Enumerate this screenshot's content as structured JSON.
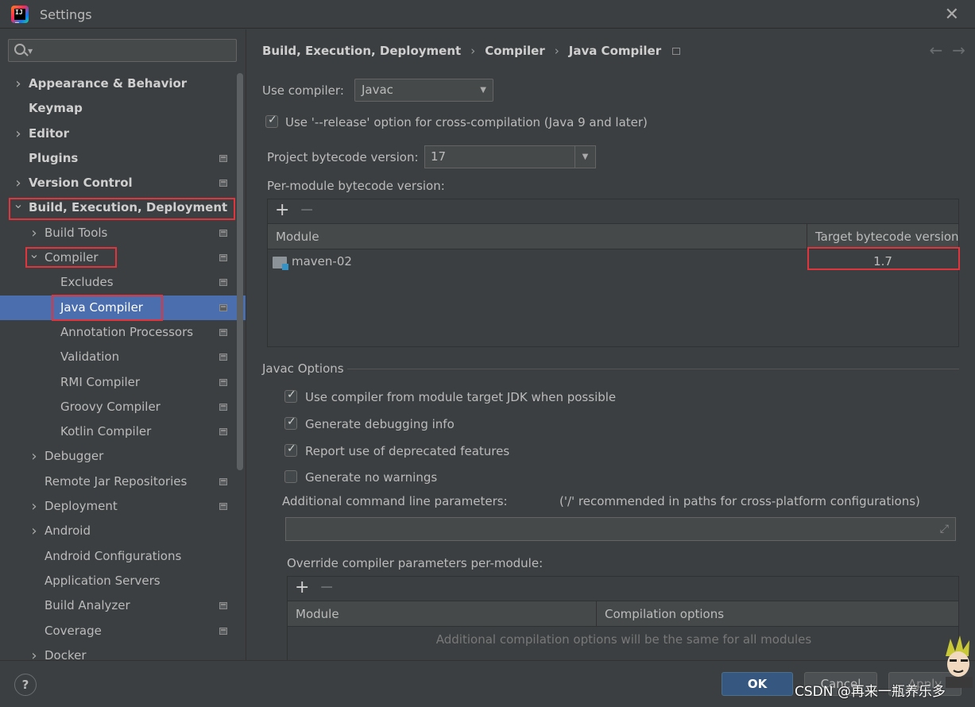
{
  "window": {
    "title": "Settings"
  },
  "search": {
    "placeholder": ""
  },
  "tree": [
    {
      "label": "Appearance & Behavior",
      "bold": true,
      "chevron": "right",
      "level": 0,
      "proj": false
    },
    {
      "label": "Keymap",
      "bold": true,
      "chevron": "",
      "level": 0,
      "proj": false
    },
    {
      "label": "Editor",
      "bold": true,
      "chevron": "right",
      "level": 0,
      "proj": false
    },
    {
      "label": "Plugins",
      "bold": true,
      "chevron": "",
      "level": 0,
      "proj": true
    },
    {
      "label": "Version Control",
      "bold": true,
      "chevron": "right",
      "level": 0,
      "proj": true
    },
    {
      "label": "Build, Execution, Deployment",
      "bold": true,
      "chevron": "down",
      "level": 0,
      "proj": false
    },
    {
      "label": "Build Tools",
      "bold": false,
      "chevron": "right",
      "level": 1,
      "proj": true
    },
    {
      "label": "Compiler",
      "bold": false,
      "chevron": "down",
      "level": 1,
      "proj": true
    },
    {
      "label": "Excludes",
      "bold": false,
      "chevron": "",
      "level": 2,
      "proj": true
    },
    {
      "label": "Java Compiler",
      "bold": false,
      "chevron": "",
      "level": 2,
      "proj": true,
      "selected": true
    },
    {
      "label": "Annotation Processors",
      "bold": false,
      "chevron": "",
      "level": 2,
      "proj": true
    },
    {
      "label": "Validation",
      "bold": false,
      "chevron": "",
      "level": 2,
      "proj": true
    },
    {
      "label": "RMI Compiler",
      "bold": false,
      "chevron": "",
      "level": 2,
      "proj": true
    },
    {
      "label": "Groovy Compiler",
      "bold": false,
      "chevron": "",
      "level": 2,
      "proj": true
    },
    {
      "label": "Kotlin Compiler",
      "bold": false,
      "chevron": "",
      "level": 2,
      "proj": true
    },
    {
      "label": "Debugger",
      "bold": false,
      "chevron": "right",
      "level": 1,
      "proj": false
    },
    {
      "label": "Remote Jar Repositories",
      "bold": false,
      "chevron": "",
      "level": 1,
      "proj": true
    },
    {
      "label": "Deployment",
      "bold": false,
      "chevron": "right",
      "level": 1,
      "proj": true
    },
    {
      "label": "Android",
      "bold": false,
      "chevron": "right",
      "level": 1,
      "proj": false
    },
    {
      "label": "Android Configurations",
      "bold": false,
      "chevron": "",
      "level": 1,
      "proj": false
    },
    {
      "label": "Application Servers",
      "bold": false,
      "chevron": "",
      "level": 1,
      "proj": false
    },
    {
      "label": "Build Analyzer",
      "bold": false,
      "chevron": "",
      "level": 1,
      "proj": true
    },
    {
      "label": "Coverage",
      "bold": false,
      "chevron": "",
      "level": 1,
      "proj": true
    },
    {
      "label": "Docker",
      "bold": false,
      "chevron": "right",
      "level": 1,
      "proj": false
    }
  ],
  "breadcrumb": {
    "part1": "Build, Execution, Deployment",
    "part2": "Compiler",
    "part3": "Java Compiler"
  },
  "use_compiler": {
    "label": "Use compiler:",
    "value": "Javac"
  },
  "release_option": {
    "label": "Use '--release' option for cross-compilation (Java 9 and later)",
    "checked": true
  },
  "bytecode": {
    "label": "Project bytecode version:",
    "value": "17"
  },
  "per_module": {
    "label": "Per-module bytecode version:",
    "columns": [
      "Module",
      "Target bytecode version"
    ],
    "rows": [
      {
        "module": "maven-02",
        "target": "1.7"
      }
    ]
  },
  "javac_options": {
    "title": "Javac Options",
    "checkboxes": [
      {
        "label": "Use compiler from module target JDK when possible",
        "checked": true
      },
      {
        "label": "Generate debugging info",
        "checked": true
      },
      {
        "label": "Report use of deprecated features",
        "checked": true
      },
      {
        "label": "Generate no warnings",
        "checked": false
      }
    ],
    "additional_label": "Additional command line parameters:",
    "additional_hint": "('/' recommended in paths for cross-platform configurations)",
    "additional_value": ""
  },
  "override": {
    "label": "Override compiler parameters per-module:",
    "columns": [
      "Module",
      "Compilation options"
    ],
    "empty_text": "Additional compilation options will be the same for all modules"
  },
  "buttons": {
    "ok": "OK",
    "cancel": "Cancel",
    "apply": "Apply",
    "help": "?"
  },
  "watermark": "CSDN @再来一瓶养乐多",
  "colors": {
    "selection": "#4b6eaf",
    "highlight_box": "#e0353c",
    "ok_button": "#365880"
  }
}
